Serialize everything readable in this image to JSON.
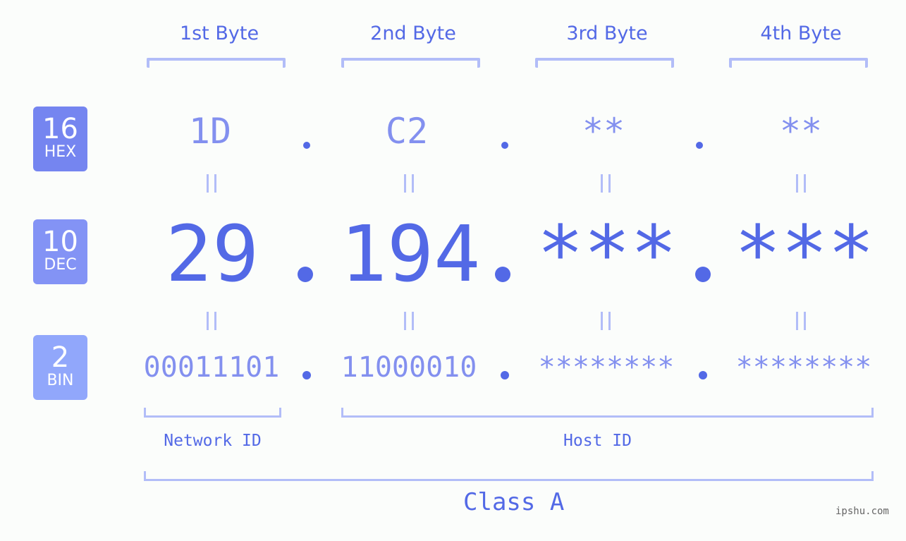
{
  "bytes": {
    "labels": [
      "1st Byte",
      "2nd Byte",
      "3rd Byte",
      "4th Byte"
    ]
  },
  "bases": {
    "hex": {
      "number": "16",
      "label": "HEX",
      "color": "#7585f0"
    },
    "dec": {
      "number": "10",
      "label": "DEC",
      "color": "#8393f5"
    },
    "bin": {
      "number": "2",
      "label": "BIN",
      "color": "#91a7fb"
    }
  },
  "hex_values": [
    "1D",
    "C2",
    "**",
    "**"
  ],
  "dec_values": [
    "29",
    "194",
    "***",
    "***"
  ],
  "bin_values": [
    "00011101",
    "11000010",
    "********",
    "********"
  ],
  "separator": ".",
  "equals": "||",
  "network_id_label": "Network ID",
  "host_id_label": "Host ID",
  "class_label": "Class A",
  "watermark": "ipshu.com",
  "colors": {
    "accent": "#5369e6",
    "light_text": "#8390ef",
    "bracket": "#b2bdf8",
    "background": "#fbfdfb"
  }
}
